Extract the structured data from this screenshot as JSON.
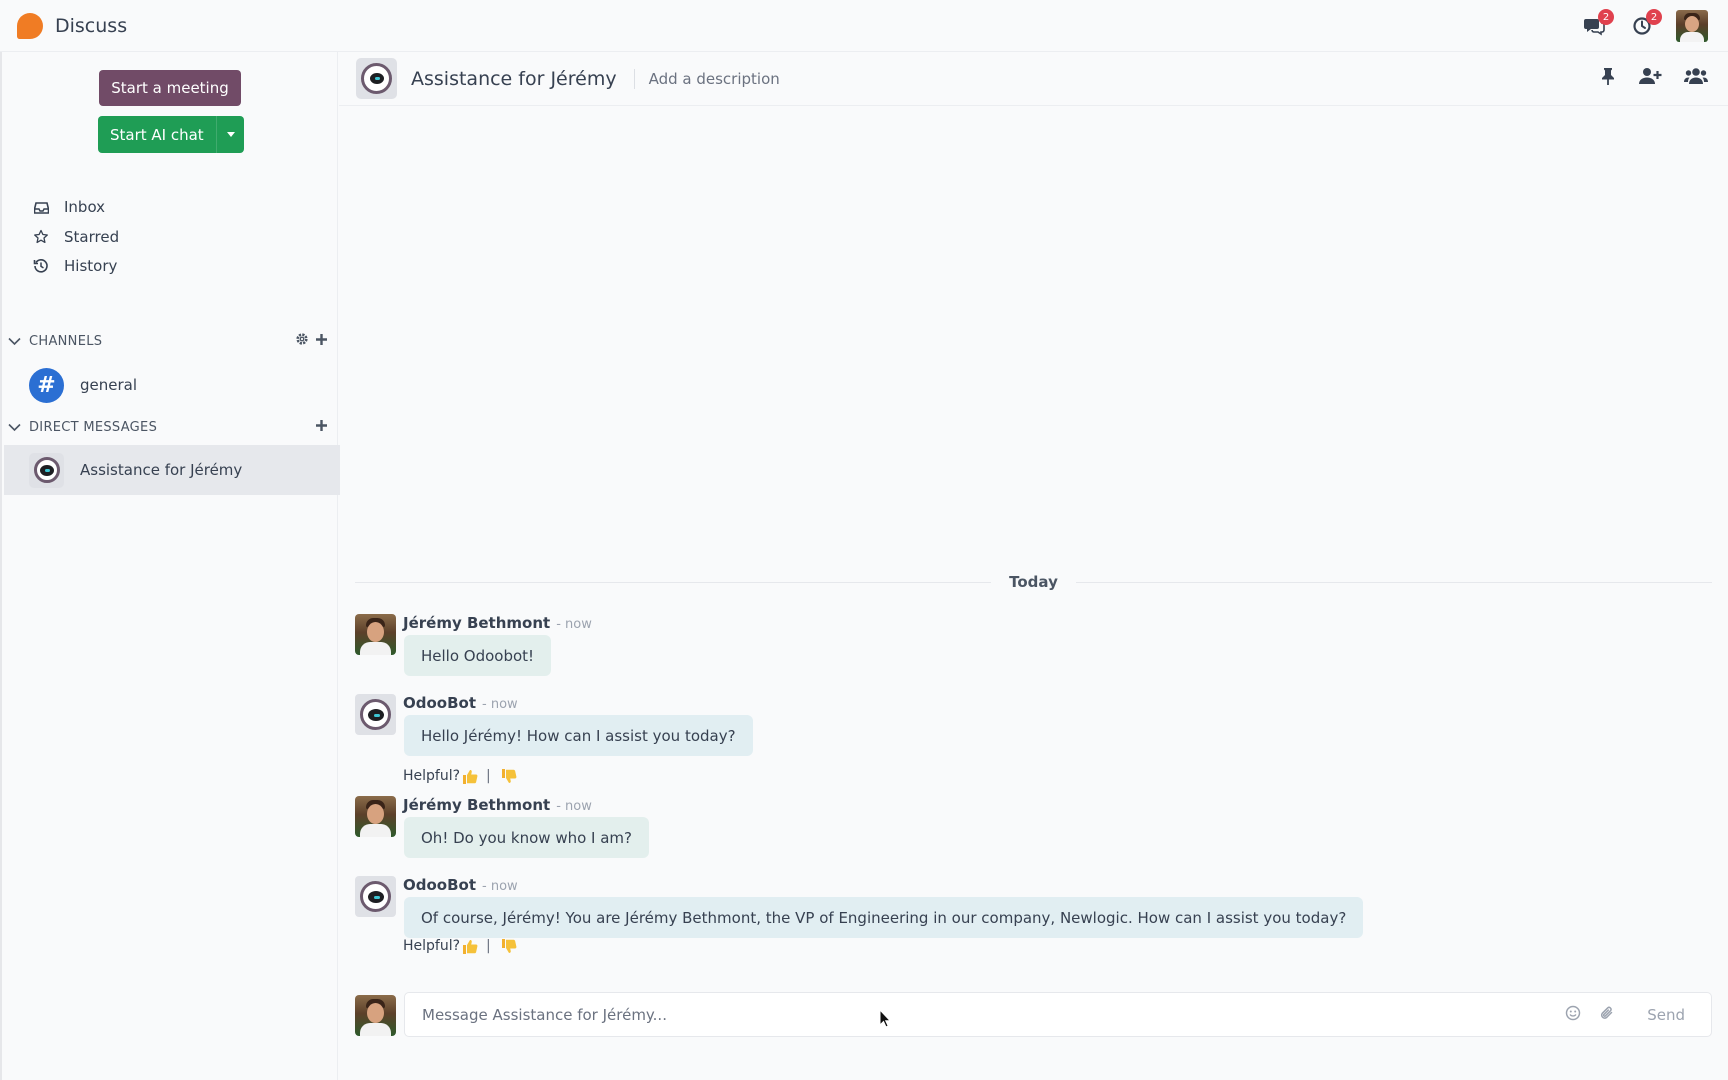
{
  "app": {
    "title": "Discuss",
    "brand_color": "#f07c24"
  },
  "systray": {
    "messages_badge": "2",
    "activities_badge": "2"
  },
  "sidebar": {
    "start_meeting_label": "Start a meeting",
    "start_ai_chat_label": "Start AI chat",
    "nav": [
      {
        "label": "Inbox",
        "icon": "inbox-icon"
      },
      {
        "label": "Starred",
        "icon": "star-icon"
      },
      {
        "label": "History",
        "icon": "history-icon"
      }
    ],
    "channels_header": "CHANNELS",
    "channels": [
      {
        "label": "general",
        "icon": "hash-icon"
      }
    ],
    "dm_header": "DIRECT MESSAGES",
    "direct_messages": [
      {
        "label": "Assistance for Jérémy",
        "active": true
      }
    ]
  },
  "thread": {
    "title": "Assistance for Jérémy",
    "description_placeholder": "Add a description",
    "date_divider": "Today",
    "messages": [
      {
        "author": "Jérémy Bethmont",
        "time": "- now",
        "body": "Hello Odoobot!",
        "kind": "user"
      },
      {
        "author": "OdooBot",
        "time": "- now",
        "body": "Hello Jérémy! How can I assist you today?",
        "kind": "bot",
        "helpful": "Helpful?"
      },
      {
        "author": "Jérémy Bethmont",
        "time": "- now",
        "body": "Oh! Do you know who I am?",
        "kind": "user"
      },
      {
        "author": "OdooBot",
        "time": "- now",
        "body": "Of course, Jérémy! You are Jérémy Bethmont, the VP of Engineering in our company, Newlogic. How can I assist you today?",
        "kind": "bot",
        "helpful": "Helpful?"
      }
    ],
    "helpful_separator": "|"
  },
  "composer": {
    "placeholder": "Message Assistance for Jérémy...",
    "value": "",
    "send_label": "Send"
  },
  "colors": {
    "meeting_button": "#714b67",
    "ai_button": "#1f9d55",
    "channel_avatar": "#2b6fd3",
    "badge": "#e0414e"
  }
}
